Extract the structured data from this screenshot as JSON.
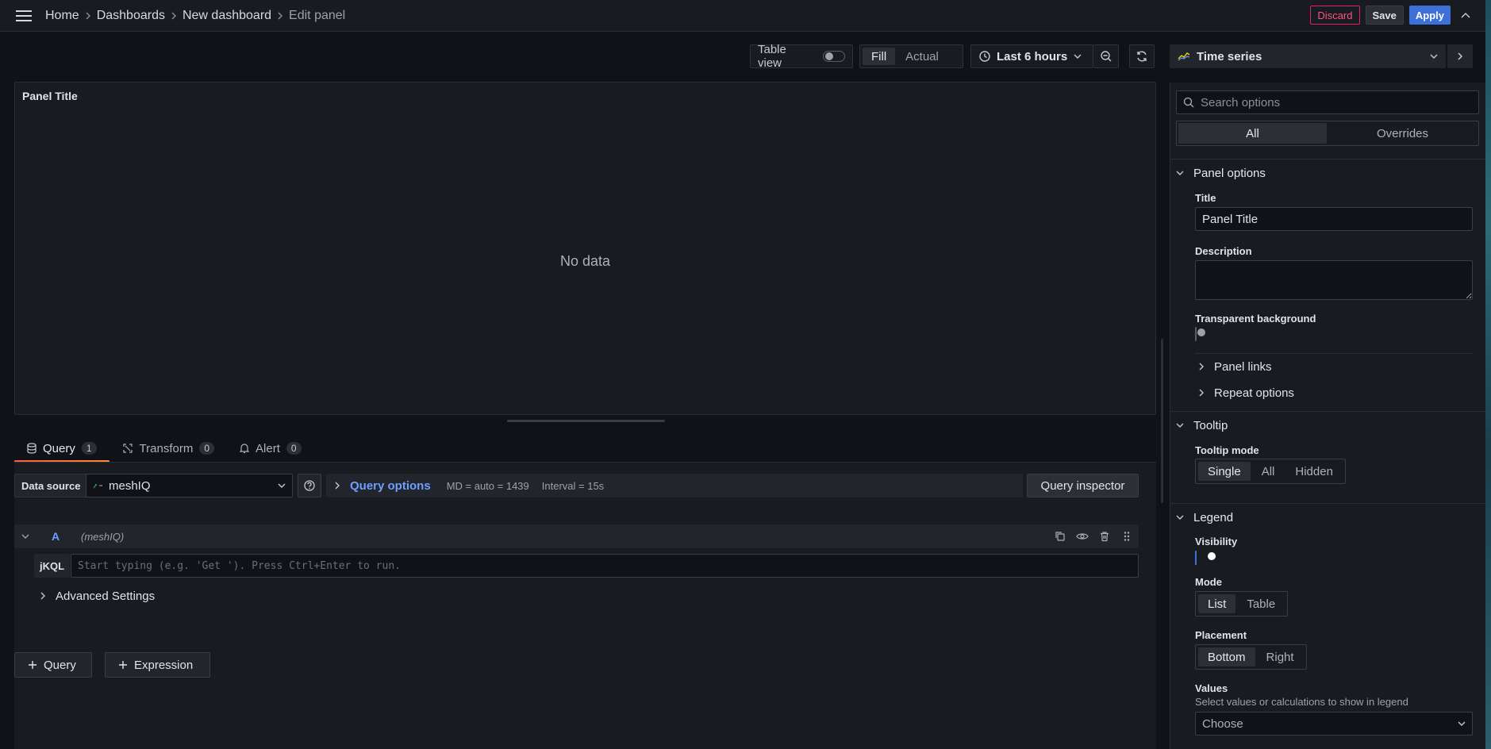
{
  "breadcrumb": [
    "Home",
    "Dashboards",
    "New dashboard",
    "Edit panel"
  ],
  "top_actions": {
    "discard": "Discard",
    "save": "Save",
    "apply": "Apply"
  },
  "toolbar": {
    "table_view_label": "Table view",
    "fill_label": "Fill",
    "actual_label": "Actual",
    "time_range": "Last 6 hours"
  },
  "visualization": {
    "name": "Time series"
  },
  "panel": {
    "title": "Panel Title",
    "no_data": "No data"
  },
  "query_tabs": [
    {
      "label": "Query",
      "count": "1"
    },
    {
      "label": "Transform",
      "count": "0"
    },
    {
      "label": "Alert",
      "count": "0"
    }
  ],
  "datasource": {
    "label": "Data source",
    "name": "meshIQ"
  },
  "query_options": {
    "label": "Query options",
    "md": "MD = auto = 1439",
    "interval": "Interval = 15s"
  },
  "query_inspector": "Query inspector",
  "query_row": {
    "letter": "A",
    "datasource": "(meshIQ)",
    "language": "jKQL",
    "placeholder": "Start typing (e.g. 'Get '). Press Ctrl+Enter to run.",
    "advanced": "Advanced Settings"
  },
  "add_buttons": {
    "query": "Query",
    "expression": "Expression"
  },
  "options": {
    "search_placeholder": "Search options",
    "tabs": [
      "All",
      "Overrides"
    ],
    "panel_options": {
      "header": "Panel options",
      "title_label": "Title",
      "title_value": "Panel Title",
      "description_label": "Description",
      "transparent_label": "Transparent background",
      "panel_links": "Panel links",
      "repeat_options": "Repeat options"
    },
    "tooltip": {
      "header": "Tooltip",
      "mode_label": "Tooltip mode",
      "modes": [
        "Single",
        "All",
        "Hidden"
      ]
    },
    "legend": {
      "header": "Legend",
      "visibility_label": "Visibility",
      "mode_label": "Mode",
      "modes": [
        "List",
        "Table"
      ],
      "placement_label": "Placement",
      "placements": [
        "Bottom",
        "Right"
      ],
      "values_label": "Values",
      "values_desc": "Select values or calculations to show in legend",
      "values_placeholder": "Choose"
    }
  }
}
